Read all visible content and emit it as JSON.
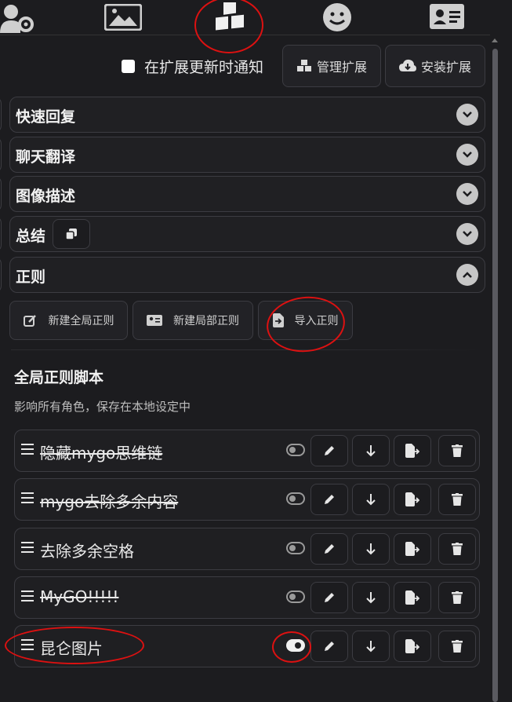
{
  "top_tabs": [
    {
      "icon": "user-gear-icon"
    },
    {
      "icon": "image-icon"
    },
    {
      "icon": "cubes-icon",
      "active": true
    },
    {
      "icon": "smile-icon"
    },
    {
      "icon": "id-card-icon"
    }
  ],
  "extensions": {
    "notify_label": "在扩展更新时通知",
    "notify_checked": false,
    "manage_label": "管理扩展",
    "install_label": "安装扩展"
  },
  "drawers": [
    {
      "title": "快速回复",
      "expanded": false
    },
    {
      "title": "聊天翻译",
      "expanded": false
    },
    {
      "title": "图像描述",
      "expanded": false
    },
    {
      "title": "总结",
      "expanded": false
    },
    {
      "title": "正则",
      "expanded": true
    }
  ],
  "regex": {
    "new_global_label": "新建全局正则",
    "new_local_label": "新建局部正则",
    "import_label": "导入正则",
    "section_title": "全局正则脚本",
    "section_desc": "影响所有角色，保存在本地设定中",
    "scripts": [
      {
        "name": "隐藏mygo思维链",
        "enabled": false
      },
      {
        "name": "mygo去除多余内容",
        "enabled": false
      },
      {
        "name": "去除多余空格",
        "enabled": false
      },
      {
        "name": "MyGO!!!!!",
        "enabled": false
      },
      {
        "name": "昆仑图片",
        "enabled": true
      }
    ]
  },
  "colors": {
    "background": "#1c1c1f",
    "border": "#3c3c42",
    "annotation": "#d11111"
  }
}
